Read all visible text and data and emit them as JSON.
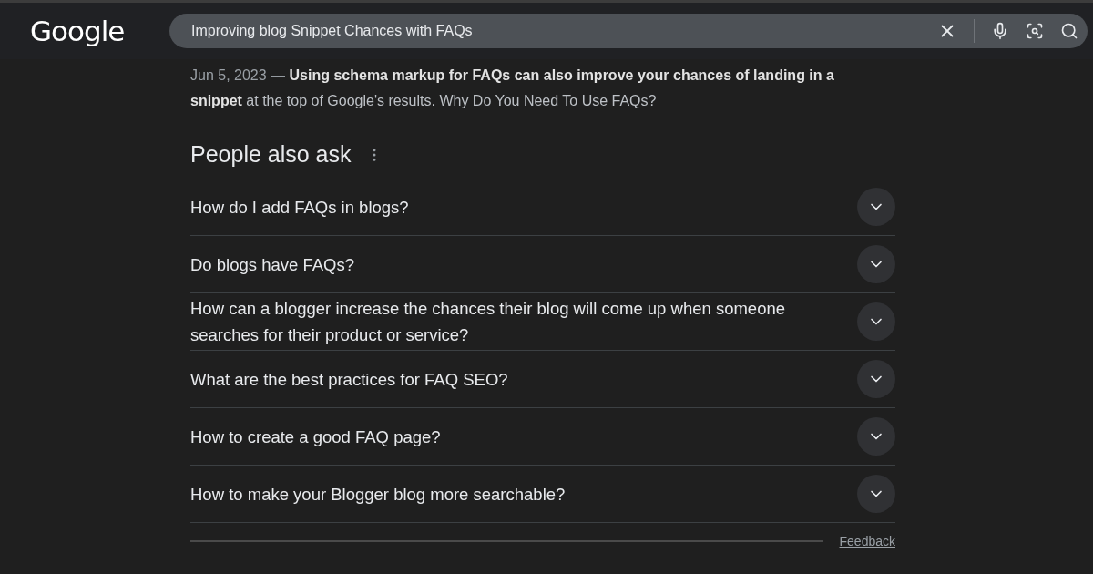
{
  "header": {
    "logo": "Google",
    "search": {
      "value": "Improving blog Snippet Chances with FAQs"
    }
  },
  "snippet": {
    "date": "Jun 5, 2023 —",
    "text": "**Using schema markup for FAQs can also improve your chances of landing in a snippet** at the top of Google's results. Why Do You Need To Use FAQs?"
  },
  "people_also_ask": {
    "title": "People also ask",
    "questions": [
      {
        "text": "How do I add FAQs in blogs?",
        "expanded": false
      },
      {
        "text": "Do blogs have FAQs?",
        "expanded": false
      },
      {
        "text": "How can a blogger increase the chances their blog will come up when someone searches for their product or service?",
        "expanded": false
      },
      {
        "text": "What are the best practices for FAQ SEO?",
        "expanded": false
      },
      {
        "text": "How to create a good FAQ page?",
        "expanded": false
      },
      {
        "text": "How to make your Blogger blog more searchable?",
        "expanded": false
      }
    ],
    "feedback": "Feedback"
  }
}
